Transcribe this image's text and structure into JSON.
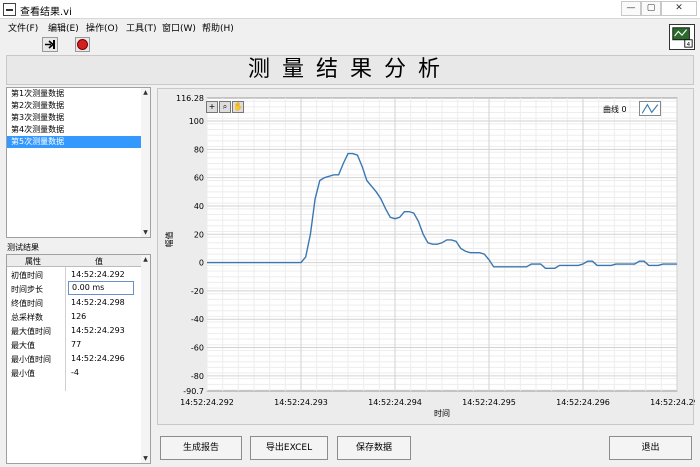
{
  "window": {
    "title": "查看结果.vi",
    "controls": {
      "minimize": "—",
      "maximize": "▢",
      "close": "✕"
    }
  },
  "menu": [
    {
      "label": "文件(F)"
    },
    {
      "label": "编辑(E)"
    },
    {
      "label": "操作(O)"
    },
    {
      "label": "工具(T)"
    },
    {
      "label": "窗口(W)"
    },
    {
      "label": "帮助(H)"
    }
  ],
  "toolbar": {
    "run_icon": "run-arrow-icon",
    "stop_icon": "abort-stop-icon"
  },
  "header": {
    "title": "测量结果分析"
  },
  "measurements": [
    {
      "label": "第1次测量数据"
    },
    {
      "label": "第2次测量数据"
    },
    {
      "label": "第3次测量数据"
    },
    {
      "label": "第4次测量数据"
    },
    {
      "label": "第5次测量数据",
      "selected": true
    }
  ],
  "results": {
    "label": "测试结果",
    "col_name": "属性",
    "col_value": "值",
    "rows": [
      {
        "name": "初值时间",
        "value": "14:52:24.292"
      },
      {
        "name": "时间步长",
        "value": "0.00 ms"
      },
      {
        "name": "终值时间",
        "value": "14:52:24.298"
      },
      {
        "name": "总采样数",
        "value": "126"
      },
      {
        "name": "最大值时间",
        "value": "14:52:24.293"
      },
      {
        "name": "最大值",
        "value": "77"
      },
      {
        "name": "最小值时间",
        "value": "14:52:24.296"
      },
      {
        "name": "最小值",
        "value": "-4"
      }
    ]
  },
  "chart_data": {
    "type": "line",
    "xlabel": "时间",
    "ylabel": "幅值",
    "ylim": [
      -90.7,
      116.28
    ],
    "y_ticks": [
      "116.28",
      "100",
      "80",
      "60",
      "40",
      "20",
      "0",
      "-20",
      "-40",
      "-60",
      "-80",
      "-90.7"
    ],
    "x_ticks": [
      "14:52:24.292",
      "14:52:24.293",
      "14:52:24.294",
      "14:52:24.295",
      "14:52:24.296",
      "14:52:24.297",
      "14:52:24.29"
    ],
    "grid": true,
    "legend": "top-right",
    "legend_label": "曲线 0",
    "line_color": "#3a77b0",
    "series": [
      {
        "x": [
          0,
          0.1,
          0.2,
          0.3,
          0.4,
          0.5,
          0.6,
          0.7,
          0.8,
          0.9,
          1.0,
          1.05,
          1.1,
          1.15,
          1.2,
          1.25,
          1.3,
          1.35,
          1.4,
          1.45,
          1.5,
          1.55,
          1.6,
          1.65,
          1.7,
          1.75,
          1.8,
          1.85,
          1.9,
          1.95,
          2.0,
          2.05,
          2.1,
          2.15,
          2.2,
          2.25,
          2.3,
          2.35,
          2.4,
          2.45,
          2.5,
          2.55,
          2.6,
          2.65,
          2.7,
          2.75,
          2.8,
          2.85,
          2.9,
          2.95,
          3.0,
          3.05,
          3.1,
          3.15,
          3.2,
          3.25,
          3.3,
          3.35,
          3.4,
          3.45,
          3.5,
          3.55,
          3.6,
          3.65,
          3.7,
          3.75,
          3.8,
          3.85,
          3.9,
          3.95,
          4.0,
          4.05,
          4.1,
          4.15,
          4.2,
          4.25,
          4.3,
          4.35,
          4.4,
          4.45,
          4.5,
          4.55,
          4.6,
          4.65,
          4.7,
          4.75,
          4.8,
          4.85,
          4.9,
          4.95,
          5.0,
          5.05,
          5.1,
          5.15,
          5.2,
          5.25,
          5.3,
          5.35,
          5.4,
          5.45,
          5.5,
          5.55,
          5.6,
          5.65,
          5.7,
          5.75,
          5.8,
          5.85,
          5.9,
          5.95,
          6.0,
          6.05,
          6.1
        ],
        "y": [
          0,
          0,
          0,
          0,
          0,
          0,
          0,
          0,
          0,
          0,
          0,
          4,
          20,
          45,
          58,
          60,
          61,
          62,
          62,
          70,
          77,
          77,
          76,
          68,
          58,
          54,
          50,
          45,
          38,
          32,
          31,
          32,
          36,
          36,
          35,
          29,
          20,
          14,
          13,
          13,
          14,
          16,
          16,
          15,
          10,
          8,
          7,
          7,
          7,
          6,
          2,
          -3,
          -3,
          -3,
          -3,
          -3,
          -3,
          -3,
          -3,
          -1,
          -1,
          -1,
          -4,
          -4,
          -4,
          -2,
          -2,
          -2,
          -2,
          -2,
          -1,
          1,
          1,
          -2,
          -2,
          -2,
          -2,
          -1,
          -1,
          -1,
          -1,
          -1,
          1,
          1,
          -2,
          -2,
          -2,
          -1,
          -1,
          -1,
          -1,
          1,
          1,
          1,
          1,
          1,
          1,
          1,
          1,
          1,
          1,
          1,
          1,
          1,
          1,
          1,
          1,
          1,
          1,
          1,
          1,
          1,
          1
        ]
      }
    ]
  },
  "buttons": {
    "report": "生成报告",
    "excel": "导出EXCEL",
    "save": "保存数据",
    "exit": "退出"
  }
}
